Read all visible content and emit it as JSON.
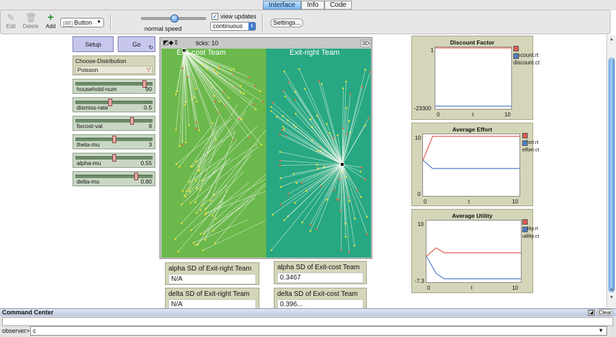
{
  "tabs": [
    {
      "label": "Interface",
      "active": true
    },
    {
      "label": "Info",
      "active": false
    },
    {
      "label": "Code",
      "active": false
    }
  ],
  "toolbar": {
    "edit_label": "Edit",
    "delete_label": "Delete",
    "add_label": "Add",
    "widget_type": "Button",
    "speed_label": "normal speed",
    "speed_fraction": 0.5,
    "view_updates_label": "view updates",
    "view_updates_checked": true,
    "update_mode": "continuous",
    "settings_label": "Settings..."
  },
  "buttons": {
    "setup": "Setup",
    "go": "Go"
  },
  "chooser": {
    "label": "Choose-Distribution",
    "value": "Poisson"
  },
  "sliders": [
    {
      "label": "household-num",
      "value": "90",
      "fraction": 0.92
    },
    {
      "label": "dismiss-rate",
      "value": "0.5",
      "fraction": 0.45
    },
    {
      "label": "fixcost-val",
      "value": "9",
      "fraction": 0.75
    },
    {
      "label": "theta-mu",
      "value": "3",
      "fraction": 0.5
    },
    {
      "label": "alpha-mu",
      "value": "0.55",
      "fraction": 0.5
    },
    {
      "label": "delta-mu",
      "value": "0.80",
      "fraction": 0.8
    }
  ],
  "view": {
    "ticks_label": "ticks: 10",
    "three_d_label": "3D",
    "left_title": "Exit-cost Team",
    "right_title": "Exit-right Team",
    "left_color": "#6bb84c",
    "right_color": "#27a882"
  },
  "monitors": [
    {
      "label": "alpha SD of Exit-right Team",
      "value": "N/A"
    },
    {
      "label": "alpha SD of Exit-cost Team",
      "value": "0.3467"
    },
    {
      "label": "delta SD of Exit-right Team",
      "value": "N/A"
    },
    {
      "label": "delta SD of Exit-cost Team",
      "value": "0.396..."
    }
  ],
  "plots": [
    {
      "title": "Discount Factor",
      "ymax_label": "1",
      "ymin_label": "-23300",
      "x0_label": "0",
      "xlabel": "t",
      "xmax_label": "10",
      "legend": [
        {
          "name": "discount.rt",
          "color": "#e05a4e"
        },
        {
          "name": "discount.ct",
          "color": "#4f7ec9"
        }
      ]
    },
    {
      "title": "Average Effort",
      "ymax_label": "10",
      "ymin_label": "0",
      "x0_label": "0",
      "xlabel": "t",
      "xmax_label": "10",
      "legend": [
        {
          "name": "effort.rt",
          "color": "#e05a4e"
        },
        {
          "name": "effort.ct",
          "color": "#4f7ec9"
        }
      ]
    },
    {
      "title": "Average Utility",
      "ymax_label": "10",
      "ymin_label": "-7.3",
      "x0_label": "0",
      "xlabel": "t",
      "xmax_label": "10",
      "legend": [
        {
          "name": "utility.rt",
          "color": "#e05a4e"
        },
        {
          "name": "utility.ct",
          "color": "#4f7ec9"
        }
      ]
    }
  ],
  "command_center": {
    "title": "Command Center",
    "clear_label": "Clear",
    "prompt_label": "observer>",
    "input_value": "c"
  }
}
